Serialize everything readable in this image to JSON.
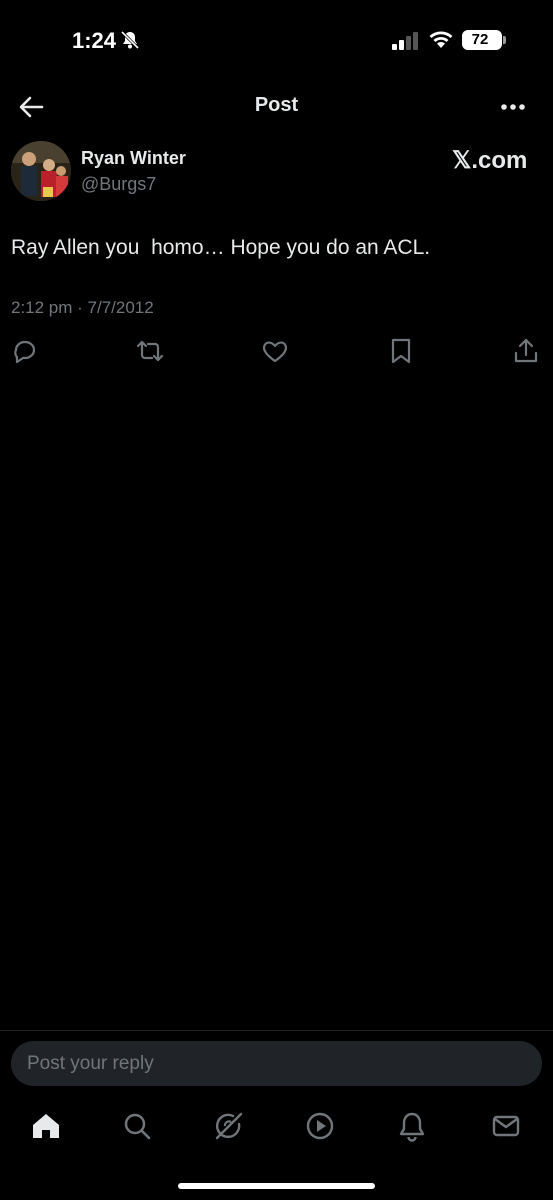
{
  "status_bar": {
    "time": "1:24",
    "battery": "72"
  },
  "header": {
    "title": "Post"
  },
  "post": {
    "author_name": "Ryan Winter",
    "author_handle": "@Burgs7",
    "brand": "𝕏.com",
    "text": "Ray Allen you  homo… Hope you do an ACL.",
    "timestamp": "2:12 pm · 7/7/2012"
  },
  "reply": {
    "placeholder": "Post your reply"
  },
  "icons": {
    "back": "arrow-left-icon",
    "more": "more-dots-icon",
    "reply": "reply-icon",
    "repost": "repost-icon",
    "like": "heart-icon",
    "bookmark": "bookmark-icon",
    "share": "share-icon",
    "nav": [
      "home-icon",
      "search-icon",
      "grok-icon",
      "video-icon",
      "notifications-icon",
      "messages-icon"
    ]
  },
  "colors": {
    "background": "#000000",
    "text": "#e7e9ea",
    "secondary": "#71767b",
    "reply_bg": "#202327"
  }
}
